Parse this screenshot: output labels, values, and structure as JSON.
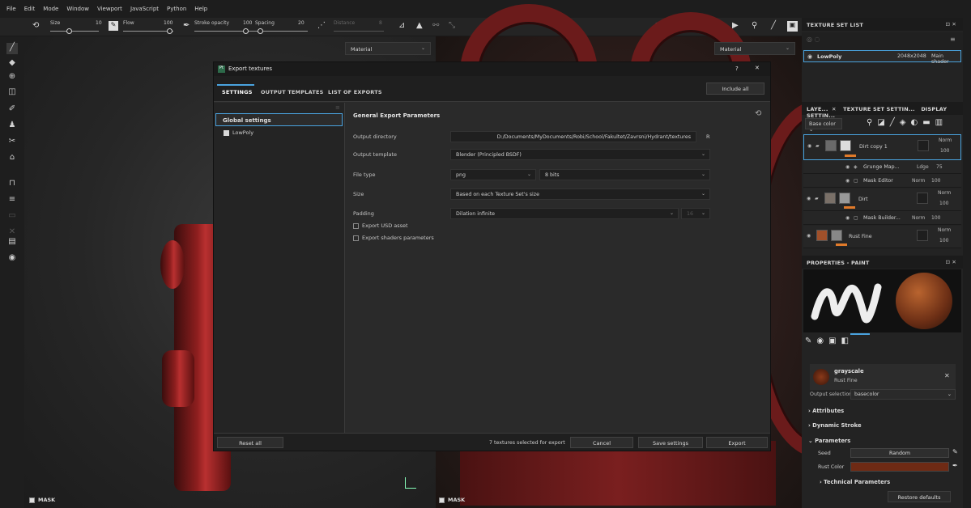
{
  "menu": [
    "File",
    "Edit",
    "Mode",
    "Window",
    "Viewport",
    "JavaScript",
    "Python",
    "Help"
  ],
  "toolbar": {
    "size_label": "Size",
    "size_value": "10",
    "flow_label": "Flow",
    "flow_value": "100",
    "stroke_label": "Stroke opacity",
    "stroke_value": "100",
    "spacing_label": "Spacing",
    "spacing_value": "20",
    "distance_label": "Distance",
    "distance_value": "8"
  },
  "viewport": {
    "material_left": "Material",
    "material_right": "Material",
    "mask_left": "MASK",
    "mask_right": "MASK"
  },
  "dialog": {
    "title": "Export textures",
    "tabs": [
      "SETTINGS",
      "OUTPUT TEMPLATES",
      "LIST OF EXPORTS"
    ],
    "include_all": "Include all",
    "global_settings": "Global settings",
    "texture_set": "LowPoly",
    "section_title": "General Export Parameters",
    "params": {
      "output_directory_label": "Output directory",
      "output_directory_value": "D:/Documents/MyDocuments/Robi/School/Fakultet/Zavrsni/Hydrant/textures",
      "output_directory_btn": "R",
      "output_template_label": "Output template",
      "output_template_value": "Blender (Principled BSDF)",
      "file_type_label": "File type",
      "file_type_value": "png",
      "bits_value": "8 bits",
      "size_label": "Size",
      "size_value": "Based on each Texture Set's size",
      "padding_label": "Padding",
      "padding_value": "Dilation infinite",
      "padding_num": "16",
      "export_usd": "Export USD asset",
      "export_shaders": "Export shaders parameters"
    },
    "footer": {
      "reset": "Reset all",
      "status": "7 textures selected for export",
      "cancel": "Cancel",
      "save": "Save settings",
      "export": "Export"
    },
    "title_help": "?",
    "title_close": "✕"
  },
  "texture_set_list": {
    "title": "TEXTURE SET LIST",
    "name": "LowPoly",
    "resolution": "2048x2048",
    "shader": "Main shader"
  },
  "layers": {
    "tabs": [
      "LAYE...",
      "TEXTURE SET SETTIN...",
      "DISPLAY SETTIN..."
    ],
    "channel": "Base color",
    "items": [
      {
        "name": "Dirt copy 1",
        "blend": "Norm",
        "opacity": "100"
      },
      {
        "name": "Grunge Map...",
        "blend": "Ldge",
        "opacity": "75"
      },
      {
        "name": "Mask Editor",
        "blend": "Norm",
        "opacity": "100"
      },
      {
        "name": "Dirt",
        "blend": "Norm",
        "opacity": "100"
      },
      {
        "name": "Mask Builder...",
        "blend": "Norm",
        "opacity": "100"
      },
      {
        "name": "Rust Fine",
        "blend": "Norm",
        "opacity": "100"
      }
    ]
  },
  "properties": {
    "title": "PROPERTIES - PAINT",
    "material_name": "grayscale",
    "material_sub": "Rust Fine",
    "output_selection_label": "Output selection",
    "output_selection_value": "basecolor",
    "attributes": "Attributes",
    "dynamic_stroke": "Dynamic Stroke",
    "parameters": "Parameters",
    "seed_label": "Seed",
    "seed_value": "Random",
    "rust_color_label": "Rust Color",
    "technical_parameters": "Technical Parameters",
    "restore_defaults": "Restore defaults",
    "rust_color": "#6e2a14"
  }
}
